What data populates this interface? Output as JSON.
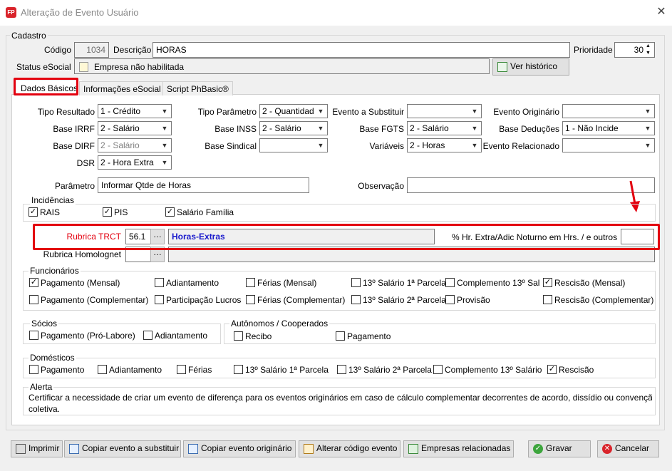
{
  "window": {
    "title": "Alteração de Evento Usuário",
    "app_icon": "FP"
  },
  "cadastro": {
    "legend": "Cadastro",
    "codigo_label": "Código",
    "codigo_value": "1034",
    "descricao_label": "Descrição",
    "descricao_value": "HORAS",
    "prioridade_label": "Prioridade",
    "prioridade_value": "30",
    "status_label": "Status eSocial",
    "status_value": "Empresa não habilitada",
    "historico_button": "Ver histórico"
  },
  "tabs": [
    "Dados Básicos",
    "Informações eSocial",
    "Script PhBasic®"
  ],
  "dados": {
    "tipo_resultado": {
      "label": "Tipo Resultado",
      "value": "1 - Crédito"
    },
    "base_irrf": {
      "label": "Base IRRF",
      "value": "2 - Salário"
    },
    "base_dirf": {
      "label": "Base DIRF",
      "value": "2 - Salário"
    },
    "dsr": {
      "label": "DSR",
      "value": "2 - Hora Extra"
    },
    "tipo_parametro": {
      "label": "Tipo Parâmetro",
      "value": "2 - Quantidad"
    },
    "base_inss": {
      "label": "Base INSS",
      "value": "2 - Salário"
    },
    "base_sindical": {
      "label": "Base Sindical",
      "value": ""
    },
    "evento_substituir": {
      "label": "Evento a Substituir",
      "value": ""
    },
    "base_fgts": {
      "label": "Base FGTS",
      "value": "2 - Salário"
    },
    "variaveis": {
      "label": "Variáveis",
      "value": "2 - Horas"
    },
    "evento_originario": {
      "label": "Evento Originário",
      "value": ""
    },
    "base_deducoes": {
      "label": "Base Deduções",
      "value": "1 - Não Incide"
    },
    "evento_relacionado": {
      "label": "Evento Relacionado",
      "value": ""
    },
    "parametro": {
      "label": "Parâmetro",
      "value": "Informar Qtde de Horas"
    },
    "observacao": {
      "label": "Observação",
      "value": ""
    }
  },
  "incidencias": {
    "legend": "Incidências",
    "items": [
      {
        "label": "RAIS",
        "checked": true
      },
      {
        "label": "PIS",
        "checked": true
      },
      {
        "label": "Salário Família",
        "checked": true
      }
    ]
  },
  "rubrica": {
    "trct_label": "Rubrica TRCT",
    "trct_code": "56.1",
    "trct_desc": "Horas-Extras",
    "hr_extra_label": "% Hr. Extra/Adic Noturno em Hrs. / e outros",
    "hr_extra_value": "",
    "homolognet_label": "Rubrica Homolognet",
    "homolognet_code": "",
    "homolognet_desc": "",
    "trct_color": "#e3000f",
    "desc_color": "#1a1acc"
  },
  "funcionarios": {
    "legend": "Funcionários",
    "items": [
      {
        "label": "Pagamento (Mensal)",
        "checked": true
      },
      {
        "label": "Adiantamento",
        "checked": false
      },
      {
        "label": "Férias (Mensal)",
        "checked": false
      },
      {
        "label": "13º Salário 1ª Parcela",
        "checked": false
      },
      {
        "label": "Complemento 13º Sal",
        "checked": false
      },
      {
        "label": "Rescisão (Mensal)",
        "checked": true
      },
      {
        "label": "Pagamento (Complementar)",
        "checked": false
      },
      {
        "label": "Participação Lucros",
        "checked": false
      },
      {
        "label": "Férias (Complementar)",
        "checked": false
      },
      {
        "label": "13º Salário 2ª Parcela",
        "checked": false
      },
      {
        "label": "Provisão",
        "checked": false
      },
      {
        "label": "Rescisão (Complementar)",
        "checked": false
      }
    ]
  },
  "socios": {
    "legend": "Sócios",
    "items": [
      {
        "label": "Pagamento (Pró-Labore)",
        "checked": false
      },
      {
        "label": "Adiantamento",
        "checked": false
      }
    ]
  },
  "autonomos": {
    "legend": "Autônomos / Cooperados",
    "items": [
      {
        "label": "Recibo",
        "checked": false
      },
      {
        "label": "Pagamento",
        "checked": false
      }
    ]
  },
  "domesticos": {
    "legend": "Domésticos",
    "items": [
      {
        "label": "Pagamento",
        "checked": false
      },
      {
        "label": "Adiantamento",
        "checked": false
      },
      {
        "label": "Férias",
        "checked": false
      },
      {
        "label": "13º Salário 1ª Parcela",
        "checked": false
      },
      {
        "label": "13º Salário 2ª Parcela",
        "checked": false
      },
      {
        "label": "Complemento 13º Salário",
        "checked": false
      },
      {
        "label": "Rescisão",
        "checked": true
      }
    ]
  },
  "alerta": {
    "legend": "Alerta",
    "line1": "Certificar a necessidade de criar um evento de diferença para os eventos originários em caso de cálculo complementar decorrentes de acordo, dissídio ou convenção",
    "line2": "coletiva."
  },
  "buttons": {
    "imprimir": "Imprimir",
    "copiar_substituir": "Copiar evento a substituir",
    "copiar_originario": "Copiar evento originário",
    "alterar_codigo": "Alterar código evento",
    "empresas": "Empresas relacionadas",
    "gravar": "Gravar",
    "cancelar": "Cancelar"
  },
  "colors": {
    "highlight": "#e3000f",
    "arrow": "#e3000f"
  }
}
